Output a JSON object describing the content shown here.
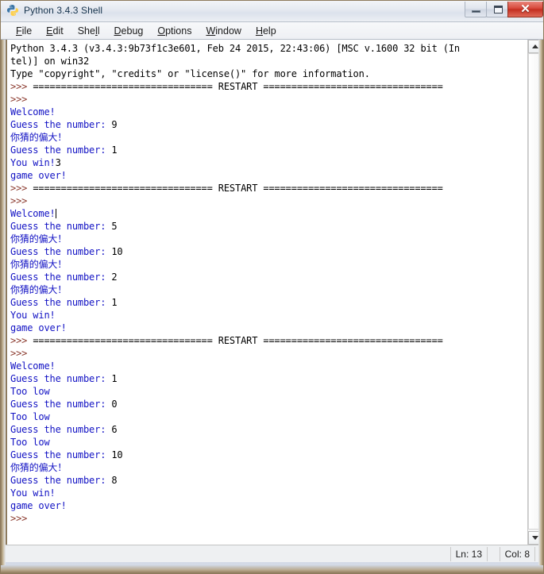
{
  "window": {
    "title": "Python 3.4.3 Shell",
    "icon": "python-logo-icon",
    "controls": {
      "minimize_label": "–",
      "maximize_label": "□",
      "close_label": "✕"
    },
    "colors": {
      "prompt": "#8b3a2e",
      "output": "#1212c4",
      "stdin": "#000000",
      "background": "#ffffff",
      "close_button": "#c32e20"
    }
  },
  "menubar": {
    "items": [
      {
        "label": "File",
        "mnemonic": "F"
      },
      {
        "label": "Edit",
        "mnemonic": "E"
      },
      {
        "label": "Shell",
        "mnemonic": "l"
      },
      {
        "label": "Debug",
        "mnemonic": "D"
      },
      {
        "label": "Options",
        "mnemonic": "O"
      },
      {
        "label": "Window",
        "mnemonic": "W"
      },
      {
        "label": "Help",
        "mnemonic": "H"
      }
    ]
  },
  "console": {
    "lines": [
      {
        "segments": [
          {
            "text": "Python 3.4.3 (v3.4.3:9b73f1c3e601, Feb 24 2015, 22:43:06) [MSC v.1600 32 bit (In",
            "style": "black"
          }
        ]
      },
      {
        "segments": [
          {
            "text": "tel)] on win32",
            "style": "black"
          }
        ]
      },
      {
        "segments": [
          {
            "text": "Type \"copyright\", \"credits\" or \"license()\" for more information.",
            "style": "black"
          }
        ]
      },
      {
        "segments": [
          {
            "text": ">>> ",
            "style": "prompt"
          },
          {
            "text": "================================ RESTART ================================",
            "style": "black"
          }
        ]
      },
      {
        "segments": [
          {
            "text": ">>> ",
            "style": "prompt"
          }
        ]
      },
      {
        "segments": [
          {
            "text": "Welcome!",
            "style": "blue"
          }
        ]
      },
      {
        "segments": [
          {
            "text": "Guess the number: ",
            "style": "blue"
          },
          {
            "text": "9",
            "style": "black"
          }
        ]
      },
      {
        "segments": [
          {
            "text": "你猜的偏大！",
            "style": "cjk"
          }
        ]
      },
      {
        "segments": [
          {
            "text": "Guess the number: ",
            "style": "blue"
          },
          {
            "text": "1",
            "style": "black"
          }
        ]
      },
      {
        "segments": [
          {
            "text": "You win!",
            "style": "blue"
          },
          {
            "text": "3",
            "style": "black"
          }
        ]
      },
      {
        "segments": [
          {
            "text": "game over!",
            "style": "blue"
          }
        ]
      },
      {
        "segments": [
          {
            "text": ">>> ",
            "style": "prompt"
          },
          {
            "text": "================================ RESTART ================================",
            "style": "black"
          }
        ]
      },
      {
        "segments": [
          {
            "text": ">>> ",
            "style": "prompt"
          }
        ]
      },
      {
        "segments": [
          {
            "text": "Welcome!",
            "style": "blue"
          },
          {
            "text": "",
            "style": "caret"
          }
        ]
      },
      {
        "segments": [
          {
            "text": "Guess the number: ",
            "style": "blue"
          },
          {
            "text": "5",
            "style": "black"
          }
        ]
      },
      {
        "segments": [
          {
            "text": "你猜的偏大！",
            "style": "cjk"
          }
        ]
      },
      {
        "segments": [
          {
            "text": "Guess the number: ",
            "style": "blue"
          },
          {
            "text": "10",
            "style": "black"
          }
        ]
      },
      {
        "segments": [
          {
            "text": "你猜的偏大！",
            "style": "cjk"
          }
        ]
      },
      {
        "segments": [
          {
            "text": "Guess the number: ",
            "style": "blue"
          },
          {
            "text": "2",
            "style": "black"
          }
        ]
      },
      {
        "segments": [
          {
            "text": "你猜的偏大！",
            "style": "cjk"
          }
        ]
      },
      {
        "segments": [
          {
            "text": "Guess the number: ",
            "style": "blue"
          },
          {
            "text": "1",
            "style": "black"
          }
        ]
      },
      {
        "segments": [
          {
            "text": "You win!",
            "style": "blue"
          }
        ]
      },
      {
        "segments": [
          {
            "text": "game over!",
            "style": "blue"
          }
        ]
      },
      {
        "segments": [
          {
            "text": ">>> ",
            "style": "prompt"
          },
          {
            "text": "================================ RESTART ================================",
            "style": "black"
          }
        ]
      },
      {
        "segments": [
          {
            "text": ">>> ",
            "style": "prompt"
          }
        ]
      },
      {
        "segments": [
          {
            "text": "Welcome!",
            "style": "blue"
          }
        ]
      },
      {
        "segments": [
          {
            "text": "Guess the number: ",
            "style": "blue"
          },
          {
            "text": "1",
            "style": "black"
          }
        ]
      },
      {
        "segments": [
          {
            "text": "Too low",
            "style": "blue"
          }
        ]
      },
      {
        "segments": [
          {
            "text": "Guess the number: ",
            "style": "blue"
          },
          {
            "text": "0",
            "style": "black"
          }
        ]
      },
      {
        "segments": [
          {
            "text": "Too low",
            "style": "blue"
          }
        ]
      },
      {
        "segments": [
          {
            "text": "Guess the number: ",
            "style": "blue"
          },
          {
            "text": "6",
            "style": "black"
          }
        ]
      },
      {
        "segments": [
          {
            "text": "Too low",
            "style": "blue"
          }
        ]
      },
      {
        "segments": [
          {
            "text": "Guess the number: ",
            "style": "blue"
          },
          {
            "text": "10",
            "style": "black"
          }
        ]
      },
      {
        "segments": [
          {
            "text": "你猜的偏大！",
            "style": "cjk"
          }
        ]
      },
      {
        "segments": [
          {
            "text": "Guess the number: ",
            "style": "blue"
          },
          {
            "text": "8",
            "style": "black"
          }
        ]
      },
      {
        "segments": [
          {
            "text": "You win!",
            "style": "blue"
          }
        ]
      },
      {
        "segments": [
          {
            "text": "game over!",
            "style": "blue"
          }
        ]
      },
      {
        "segments": [
          {
            "text": ">>> ",
            "style": "prompt"
          }
        ]
      }
    ]
  },
  "scrollbar": {
    "up_arrow": "scroll-up-icon",
    "down_arrow": "scroll-down-icon"
  },
  "statusbar": {
    "line_label": "Ln: 13",
    "col_label": "Col: 8"
  }
}
